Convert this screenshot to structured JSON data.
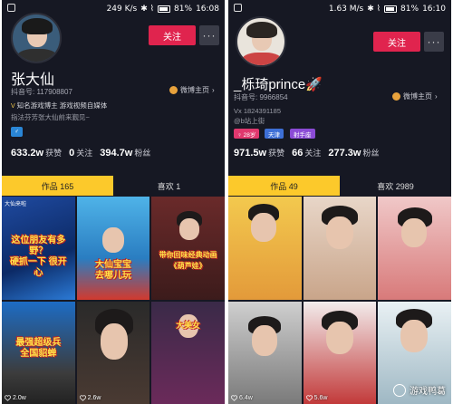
{
  "left": {
    "status": {
      "speed": "249 K/s",
      "battery": "81%",
      "time": "16:08"
    },
    "follow_label": "关注",
    "more_label": "···",
    "name": "张大仙",
    "douyin_id": "抖音号: 117908807",
    "weibo_label": "微博主页",
    "bio_verified": "知名游戏博主 游戏视频自媒体",
    "bio_line": "指法芬芳张大仙前来觐见~",
    "gender_tag": "♂",
    "stats": {
      "likes": "633.2w",
      "likes_label": "获赞",
      "following": "0",
      "following_label": "关注",
      "fans": "394.7w",
      "fans_label": "粉丝"
    },
    "tabs": {
      "works": "作品 165",
      "liked": "喜欢 1"
    },
    "corner_label": "大仙来啦",
    "grid": [
      {
        "likes": "",
        "caption": "这位朋友有多野？\n硬抓一下 很开心"
      },
      {
        "likes": "",
        "caption": "大仙宝宝\n去哪儿玩"
      },
      {
        "likes": "",
        "caption": "带你回味经典动画\n《葫芦娃》"
      },
      {
        "likes": "2.0w",
        "caption": "最强超级兵\n全国貂蝉"
      },
      {
        "likes": "2.6w",
        "caption": ""
      },
      {
        "likes": "1.5w",
        "caption": "大美女"
      }
    ]
  },
  "right": {
    "status": {
      "speed": "1.63 M/s",
      "battery": "81%",
      "time": "16:10"
    },
    "follow_label": "关注",
    "more_label": "···",
    "name": "_栎琦prince🚀",
    "douyin_id": "抖音号: 9966854",
    "weibo_label": "微博主页",
    "vx": "Vx 1824391185",
    "bio_line": "@b站上街",
    "tags": [
      "♀ 28岁",
      "天津",
      "射手座"
    ],
    "stats": {
      "likes": "971.5w",
      "likes_label": "获赞",
      "following": "66",
      "following_label": "关注",
      "fans": "277.3w",
      "fans_label": "粉丝"
    },
    "tabs": {
      "works": "作品 49",
      "liked": "喜欢 2989"
    },
    "grid": [
      {
        "likes": ""
      },
      {
        "likes": ""
      },
      {
        "likes": ""
      },
      {
        "likes": "6.4w"
      },
      {
        "likes": "5.6w"
      },
      {
        "likes": ""
      }
    ],
    "watermark": "游戏鸭葛"
  }
}
